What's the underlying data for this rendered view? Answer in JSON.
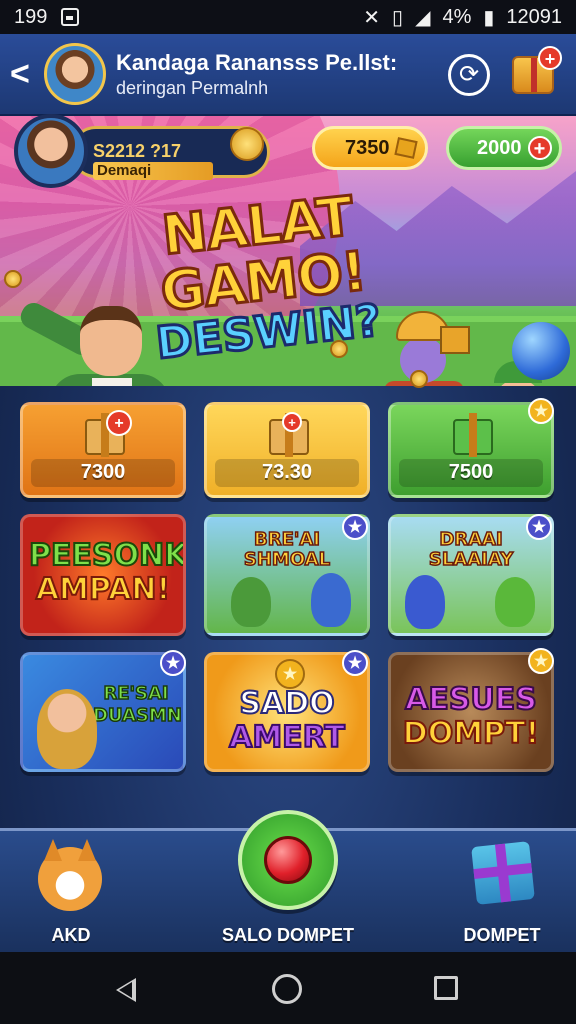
{
  "status_bar": {
    "left_number": "199",
    "battery_pct": "4%",
    "time": "12091"
  },
  "header": {
    "title": "Kandaga Ranansss Pe.llst:",
    "subtitle": "deringan Permalnh"
  },
  "banner": {
    "player_amount": "S2212 ?17",
    "player_name": "Demaqi",
    "coin_balance": "7350",
    "gem_balance": "2000",
    "headline_1": "NALAT",
    "headline_2": "GAMO!",
    "headline_3": "DESWIN?"
  },
  "shop": [
    {
      "price": "7300",
      "color": "#f08a1e"
    },
    {
      "price": "73.30",
      "color": "#f7c23b"
    },
    {
      "price": "7500",
      "color": "#56b83c"
    }
  ],
  "games": [
    {
      "title_1": "PEESONK",
      "title_2": "AMPAN!"
    },
    {
      "title_1": "BRE'AI",
      "title_2": "SHMOAL"
    },
    {
      "title_1": "DRAAI",
      "title_2": "SLAAIAY"
    },
    {
      "title_1": "RE'SAI",
      "title_2": "DUASMN"
    },
    {
      "title_1": "SADO",
      "title_2": "AMERT"
    },
    {
      "title_1": "AESUES",
      "title_2": "DOMPT!"
    }
  ],
  "nav": {
    "left_label": "AKD",
    "center_label": "SALO DOMPET",
    "right_label": "DOMPET"
  }
}
